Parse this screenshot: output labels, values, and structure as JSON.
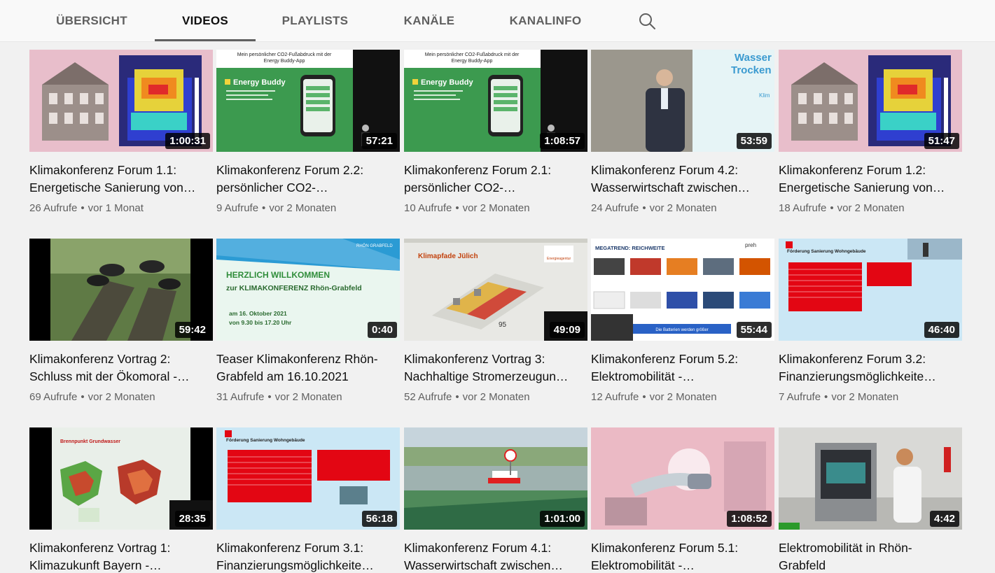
{
  "tabs": [
    {
      "label": "ÜBERSICHT",
      "active": false
    },
    {
      "label": "VIDEOS",
      "active": true
    },
    {
      "label": "PLAYLISTS",
      "active": false
    },
    {
      "label": "KANÄLE",
      "active": false
    },
    {
      "label": "KANALINFO",
      "active": false
    }
  ],
  "search_icon": "search-icon",
  "videos": [
    {
      "title1": "Klimakonferenz Forum 1.1:",
      "title2": "Energetische Sanierung von…",
      "duration": "1:00:31",
      "views": "26 Aufrufe",
      "age": "vor 1 Monat",
      "thumb_text": ""
    },
    {
      "title1": "Klimakonferenz Forum 2.2:",
      "title2": "persönlicher CO2-…",
      "duration": "57:21",
      "views": "9 Aufrufe",
      "age": "vor 2 Monaten",
      "thumb_text": "Energy Buddy"
    },
    {
      "title1": "Klimakonferenz Forum 2.1:",
      "title2": "persönlicher CO2-…",
      "duration": "1:08:57",
      "views": "10 Aufrufe",
      "age": "vor 2 Monaten",
      "thumb_text": "Energy Buddy"
    },
    {
      "title1": "Klimakonferenz Forum 4.2:",
      "title2": "Wasserwirtschaft zwischen…",
      "duration": "53:59",
      "views": "24 Aufrufe",
      "age": "vor 2 Monaten",
      "thumb_text": "Wasser Trocken"
    },
    {
      "title1": "Klimakonferenz Forum 1.2:",
      "title2": "Energetische Sanierung von…",
      "duration": "51:47",
      "views": "18 Aufrufe",
      "age": "vor 2 Monaten",
      "thumb_text": ""
    },
    {
      "title1": "Klimakonferenz Vortrag 2:",
      "title2": "Schluss mit der Ökomoral -…",
      "duration": "59:42",
      "views": "69 Aufrufe",
      "age": "vor 2 Monaten",
      "thumb_text": ""
    },
    {
      "title1": "Teaser Klimakonferenz Rhön-",
      "title2": "Grabfeld am 16.10.2021",
      "duration": "0:40",
      "views": "31 Aufrufe",
      "age": "vor 2 Monaten",
      "thumb_text": "HERZLICH WILLKOMMEN"
    },
    {
      "title1": "Klimakonferenz Vortrag 3:",
      "title2": "Nachhaltige Stromerzeugun…",
      "duration": "49:09",
      "views": "52 Aufrufe",
      "age": "vor 2 Monaten",
      "thumb_text": "Klimapfade Jülich"
    },
    {
      "title1": "Klimakonferenz Forum 5.2:",
      "title2": "Elektromobilität -…",
      "duration": "55:44",
      "views": "12 Aufrufe",
      "age": "vor 2 Monaten",
      "thumb_text": "MEGATREND: REICHWEITE"
    },
    {
      "title1": "Klimakonferenz Forum 3.2:",
      "title2": "Finanzierungsmöglichkeite…",
      "duration": "46:40",
      "views": "7 Aufrufe",
      "age": "vor 2 Monaten",
      "thumb_text": "Förderung Sanierung Wohngebäude"
    },
    {
      "title1": "Klimakonferenz Vortrag 1:",
      "title2": "Klimazukunft Bayern -…",
      "duration": "28:35",
      "views": "",
      "age": "",
      "thumb_text": "Brennpunkt Grundwasser"
    },
    {
      "title1": "Klimakonferenz Forum 3.1:",
      "title2": "Finanzierungsmöglichkeite…",
      "duration": "56:18",
      "views": "",
      "age": "",
      "thumb_text": "Förderung Sanierung Wohngebäude"
    },
    {
      "title1": "Klimakonferenz Forum 4.1:",
      "title2": "Wasserwirtschaft zwischen…",
      "duration": "1:01:00",
      "views": "",
      "age": "",
      "thumb_text": ""
    },
    {
      "title1": "Klimakonferenz Forum 5.1:",
      "title2": "Elektromobilität -…",
      "duration": "1:08:52",
      "views": "",
      "age": "",
      "thumb_text": ""
    },
    {
      "title1": "Elektromobilität in Rhön-",
      "title2": "Grabfeld",
      "duration": "4:42",
      "views": "",
      "age": "",
      "thumb_text": ""
    }
  ]
}
